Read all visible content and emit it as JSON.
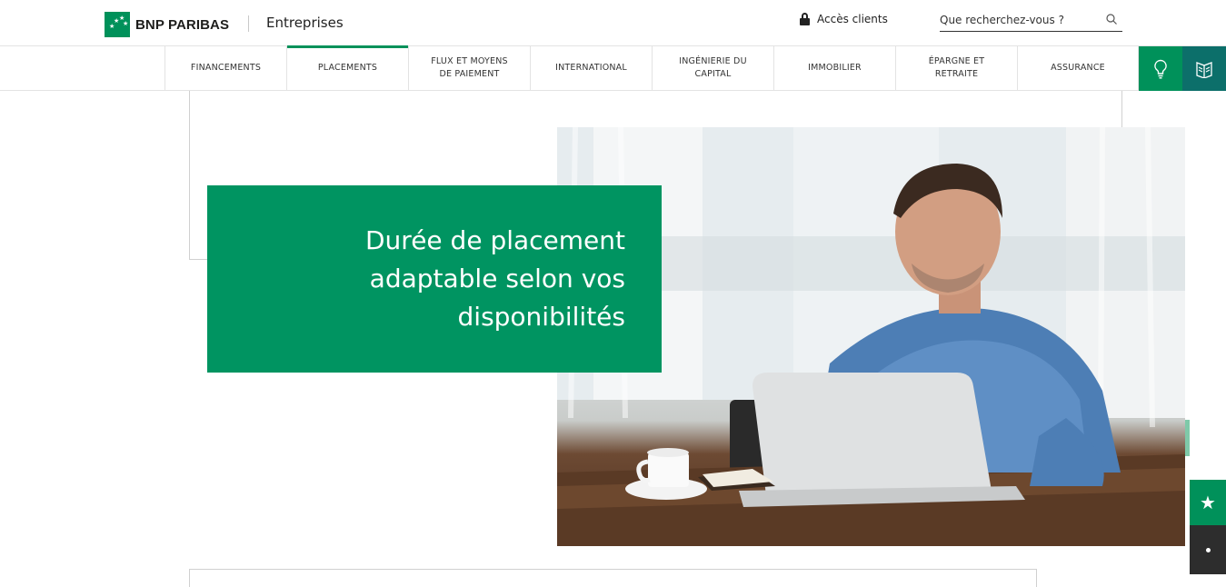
{
  "header": {
    "brand": "BNP PARIBAS",
    "segment": "Entreprises",
    "access_label": "Accès clients",
    "search_placeholder": "Que recherchez-vous ?"
  },
  "nav": {
    "items": [
      {
        "label": "FINANCEMENTS",
        "active": false
      },
      {
        "label": "PLACEMENTS",
        "active": true
      },
      {
        "label": "FLUX ET MOYENS DE PAIEMENT",
        "active": false
      },
      {
        "label": "INTERNATIONAL",
        "active": false
      },
      {
        "label": "INGÉNIERIE DU CAPITAL",
        "active": false
      },
      {
        "label": "IMMOBILIER",
        "active": false
      },
      {
        "label": "ÉPARGNE ET RETRAITE",
        "active": false
      },
      {
        "label": "ASSURANCE",
        "active": false
      }
    ],
    "icons": [
      "lightbulb-icon",
      "book-icon"
    ]
  },
  "main": {
    "promo_title": "Durée de placement adaptable selon vos disponibilités",
    "photo_alt": "lightbulb"
  },
  "side": {
    "favorite_icon": "star-icon",
    "more_icon": "dot-icon"
  },
  "colors": {
    "brand_green": "#00915a",
    "promo_green": "#009461",
    "dark_teal": "#0c6f6a"
  }
}
